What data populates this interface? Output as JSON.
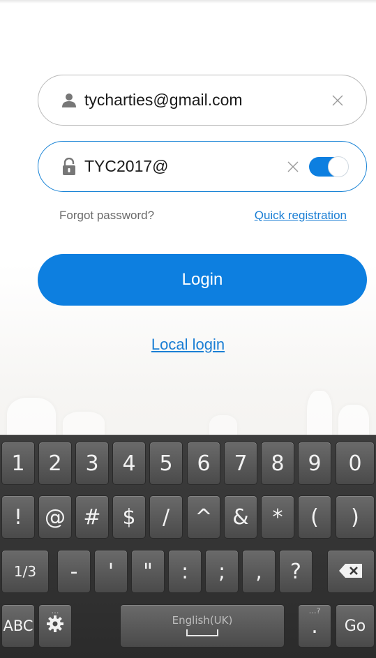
{
  "login_form": {
    "email_value": "tycharties@gmail.com",
    "password_value": "TYC2017@",
    "forgot_password": "Forgot password?",
    "quick_registration": "Quick registration",
    "login_button": "Login",
    "local_login": "Local login",
    "show_password_toggle": "on"
  },
  "keyboard": {
    "row1": [
      "1",
      "2",
      "3",
      "4",
      "5",
      "6",
      "7",
      "8",
      "9",
      "0"
    ],
    "row2": [
      "!",
      "@",
      "#",
      "$",
      "/",
      "^",
      "&",
      "*",
      "(",
      ")"
    ],
    "row3": [
      "1/3",
      "-",
      "'",
      "\"",
      ":",
      ";",
      ",",
      "?"
    ],
    "row4": {
      "abc": "ABC",
      "space_language": "English(UK)",
      "period": ".",
      "period_hint": "…?",
      "settings_hint": "…",
      "go": "Go"
    },
    "icons": [
      "backspace-icon",
      "settings-icon",
      "space-icon"
    ]
  },
  "colors": {
    "accent": "#0d7fe0",
    "link": "#1a7ed4",
    "keyboard_bg": "#2b2b2b"
  }
}
